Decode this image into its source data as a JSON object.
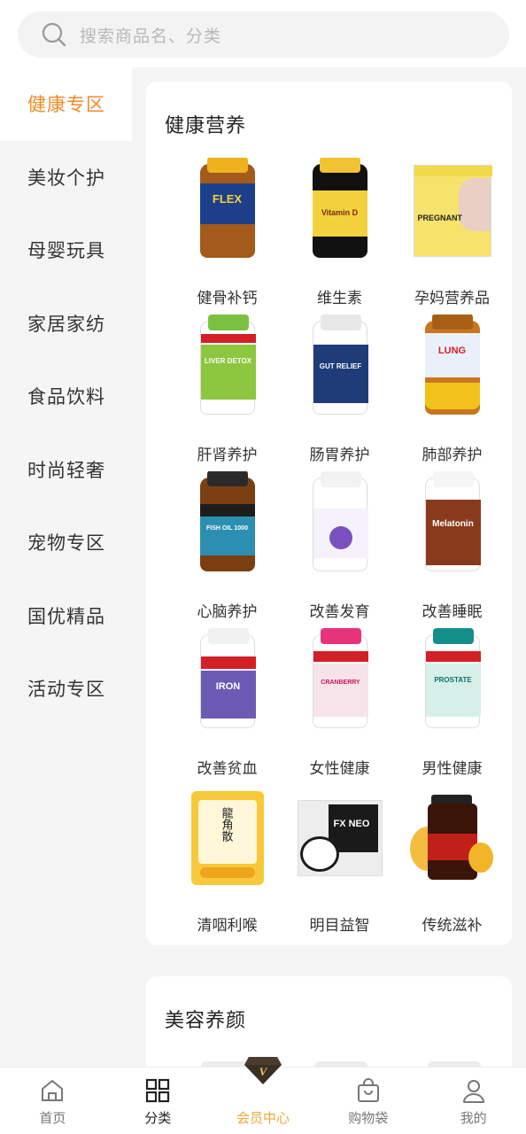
{
  "search": {
    "placeholder": "搜索商品名、分类"
  },
  "sidebar": {
    "items": [
      {
        "label": "健康专区",
        "active": true
      },
      {
        "label": "美妆个护"
      },
      {
        "label": "母婴玩具"
      },
      {
        "label": "家居家纺"
      },
      {
        "label": "食品饮料"
      },
      {
        "label": "时尚轻奢"
      },
      {
        "label": "宠物专区"
      },
      {
        "label": "国优精品"
      },
      {
        "label": "活动专区"
      }
    ]
  },
  "sections": [
    {
      "title": "健康营养",
      "items": [
        {
          "label": "健骨补钙",
          "icon": "joint-flex-bottle",
          "image_text": "FLEX"
        },
        {
          "label": "维生素",
          "icon": "vitamin-d-bottle",
          "image_text": "Vitamin D"
        },
        {
          "label": "孕妈营养品",
          "icon": "pregnant-supplement-box",
          "image_text": "PREGNANT"
        },
        {
          "label": "肝肾养护",
          "icon": "liver-detox-bottle",
          "image_text": "LIVER DETOX"
        },
        {
          "label": "肠胃养护",
          "icon": "gut-relief-bottle",
          "image_text": "GUT RELIEF"
        },
        {
          "label": "肺部养护",
          "icon": "lung-detox-bottle",
          "image_text": "LUNG"
        },
        {
          "label": "心脑养护",
          "icon": "fish-oil-bottle",
          "image_text": "FISH OIL 1000"
        },
        {
          "label": "改善发育",
          "icon": "kids-growth-bottle",
          "image_text": ""
        },
        {
          "label": "改善睡眠",
          "icon": "melatonin-bottle",
          "image_text": "Melatonin"
        },
        {
          "label": "改善贫血",
          "icon": "iron-bottle",
          "image_text": "IRON"
        },
        {
          "label": "女性健康",
          "icon": "cranberry-bottle",
          "image_text": "CRANBERRY"
        },
        {
          "label": "男性健康",
          "icon": "prostate-bottle",
          "image_text": "PROSTATE"
        },
        {
          "label": "清咽利喉",
          "icon": "throat-tablet-pack",
          "image_text": "龍角散"
        },
        {
          "label": "明目益智",
          "icon": "eye-drops-box",
          "image_text": "FX NEO"
        },
        {
          "label": "传统滋补",
          "icon": "honey-jar",
          "image_text": ""
        }
      ]
    },
    {
      "title": "美容养颜",
      "items": []
    }
  ],
  "tabbar": {
    "items": [
      {
        "label": "首页",
        "icon": "home-icon"
      },
      {
        "label": "分类",
        "icon": "category-grid-icon",
        "active": true
      },
      {
        "label": "会员中心",
        "icon": "member-diamond-icon"
      },
      {
        "label": "购物袋",
        "icon": "shopping-bag-icon"
      },
      {
        "label": "我的",
        "icon": "profile-icon"
      }
    ]
  },
  "colors": {
    "accent": "#f08a24",
    "member_gold": "#e8a93a",
    "background": "#f5f5f5"
  }
}
